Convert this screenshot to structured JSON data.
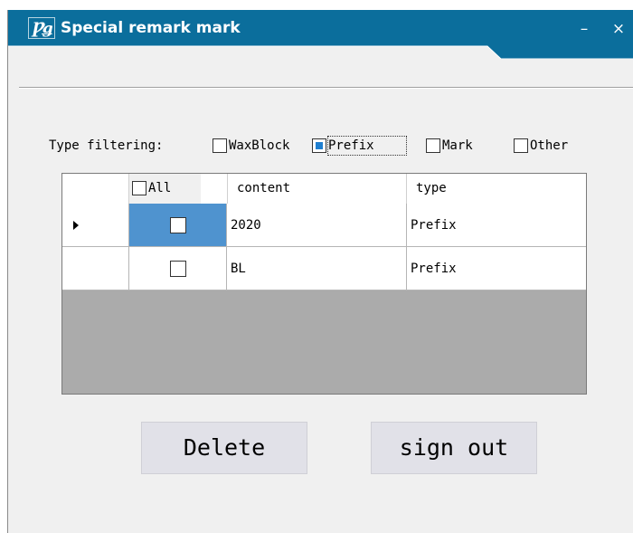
{
  "window": {
    "title": "Special remark mark",
    "icon": "app-logo-icon",
    "icon_glyph": "Ƿǥ",
    "minimize_glyph": "–",
    "close_glyph": "×",
    "titlebar_color": "#0b6e9c"
  },
  "filter": {
    "label": "Type filtering:",
    "options": [
      {
        "label": "WaxBlock",
        "checked": false
      },
      {
        "label": "Prefix",
        "checked": true
      },
      {
        "label": "Mark",
        "checked": false
      },
      {
        "label": "Other",
        "checked": false
      }
    ]
  },
  "grid": {
    "headers": {
      "all": "All",
      "content": "content",
      "type": "type"
    },
    "rows": [
      {
        "checked": false,
        "content": "2020",
        "type": "Prefix",
        "selected": true
      },
      {
        "checked": false,
        "content": "BL",
        "type": "Prefix",
        "selected": false
      }
    ],
    "selection_color": "#4f93cf"
  },
  "buttons": {
    "delete": "Delete",
    "sign_out": "sign out"
  }
}
